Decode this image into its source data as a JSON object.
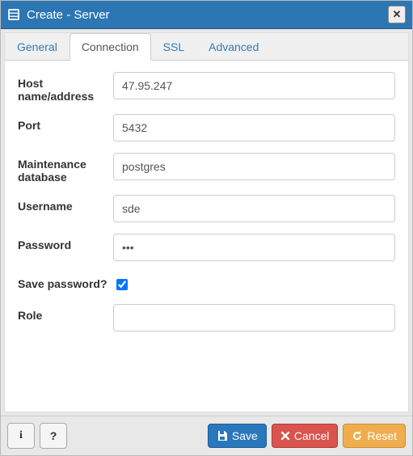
{
  "dialog": {
    "title": "Create - Server",
    "close_glyph": "✕"
  },
  "tabs": [
    {
      "id": "general",
      "label": "General",
      "active": false
    },
    {
      "id": "connection",
      "label": "Connection",
      "active": true
    },
    {
      "id": "ssl",
      "label": "SSL",
      "active": false
    },
    {
      "id": "advanced",
      "label": "Advanced",
      "active": false
    }
  ],
  "fields": {
    "host": {
      "label": "Host name/address",
      "value": "47.95.247"
    },
    "port": {
      "label": "Port",
      "value": "5432"
    },
    "maint_db": {
      "label": "Maintenance database",
      "value": "postgres"
    },
    "username": {
      "label": "Username",
      "value": "sde"
    },
    "password": {
      "label": "Password",
      "value": "•••"
    },
    "save_pw": {
      "label": "Save password?",
      "checked": true
    },
    "role": {
      "label": "Role",
      "value": ""
    }
  },
  "footer": {
    "info_glyph": "i",
    "help_glyph": "?",
    "save": "Save",
    "cancel": "Cancel",
    "reset": "Reset"
  }
}
